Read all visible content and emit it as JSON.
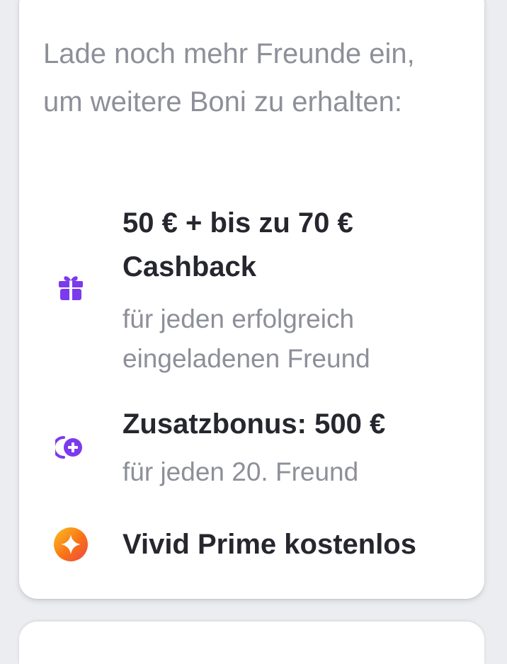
{
  "intro": {
    "text": "Lade noch mehr Freunde ein, um weitere Boni zu erhalten:"
  },
  "benefits": [
    {
      "icon": "gift-icon",
      "title": "50 € + bis zu 70 € Cashback",
      "subtitle": "für jeden erfolgreich eingeladenen Freund"
    },
    {
      "icon": "coin-plus-icon",
      "title": "Zusatzbonus: 500 €",
      "subtitle": "für jeden 20. Freund"
    },
    {
      "icon": "prime-star-icon",
      "title": "Vivid Prime kostenlos"
    }
  ],
  "colors": {
    "accent_purple": "#7c3aed",
    "prime_orange": "#f97316",
    "text_dark": "#26272e",
    "text_muted": "#8d8f99"
  }
}
